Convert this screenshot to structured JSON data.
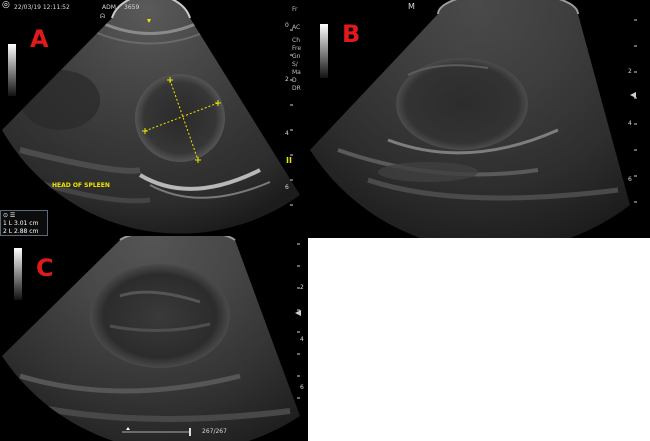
{
  "panels": {
    "a": {
      "letter": "A",
      "header": {
        "date_time": "22/03/19 12:11:52",
        "operator": "ADM",
        "id": "3659"
      },
      "annotation": "HEAD OF SPLEEN",
      "right_labels": [
        "Fr",
        "AC",
        "Ch",
        "Fre",
        "Gn",
        "S/",
        "Ma",
        "D",
        "DR"
      ],
      "depth_ticks": [
        "0",
        "2",
        "4",
        "6"
      ],
      "measurements": [
        {
          "index": "1",
          "label": "L",
          "value": "3.01 cm"
        },
        {
          "index": "2",
          "label": "L",
          "value": "2.88 cm"
        }
      ]
    },
    "b": {
      "letter": "B",
      "depth_ticks": [
        "2",
        "4",
        "6"
      ],
      "marker": "M"
    },
    "c": {
      "letter": "C",
      "depth_ticks": [
        "2",
        "4",
        "6"
      ],
      "cine_frame": "267/267"
    }
  },
  "colors": {
    "letter": "#e01a1a",
    "caliper": "#f2e600",
    "background": "#000000"
  }
}
